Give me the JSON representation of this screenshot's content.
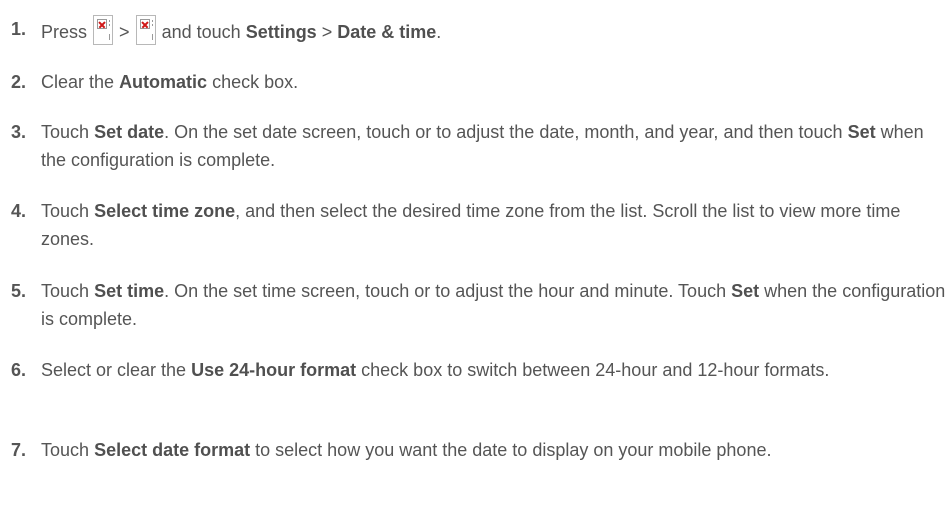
{
  "steps": [
    {
      "num": "1.",
      "t1": "Press",
      "t2": ">",
      "t3": "and touch",
      "b1": "Settings",
      "t4": ">",
      "b2": "Date & time",
      "t5": ".",
      "icons": [
        "broken-image-icon",
        "broken-image-icon"
      ]
    },
    {
      "num": "2.",
      "t1": "Clear the",
      "b1": "Automatic",
      "t2": "check box."
    },
    {
      "num": "3.",
      "t1": "Touch",
      "b1": "Set date",
      "t2": ". On the set date screen, touch or to adjust the date, month, and year, and then touch",
      "b2": "Set",
      "t3": "when the configuration is complete."
    },
    {
      "num": "4.",
      "t1": "Touch",
      "b1": "Select time zone",
      "t2": ", and then select the desired time zone from the list. Scroll the list to view more time zones."
    },
    {
      "num": "5.",
      "t1": "Touch",
      "b1": "Set time",
      "t2": ". On the set time screen, touch or to adjust the hour and minute. Touch",
      "b2": "Set",
      "t3": "when the configuration is complete."
    },
    {
      "num": "6.",
      "t1": "Select or clear the",
      "b1": "Use 24-hour format",
      "t2": "check box to switch between 24-hour and 12-hour formats."
    },
    {
      "num": "7.",
      "t1": "Touch",
      "b1": "Select date format",
      "t2": "to select how you want the date to display on your mobile phone."
    }
  ]
}
